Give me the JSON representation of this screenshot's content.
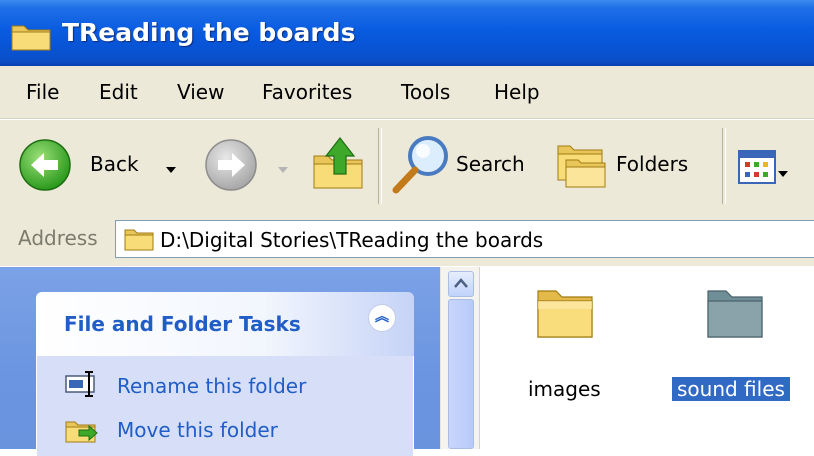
{
  "window": {
    "title": "TReading the boards"
  },
  "menu": {
    "items": [
      "File",
      "Edit",
      "View",
      "Favorites",
      "Tools",
      "Help"
    ]
  },
  "toolbar": {
    "back_label": "Back",
    "search_label": "Search",
    "folders_label": "Folders"
  },
  "address": {
    "label": "Address",
    "value": "D:\\Digital Stories\\TReading the boards"
  },
  "task_panel": {
    "title": "File and Folder Tasks",
    "items": [
      {
        "label": "Rename this folder",
        "icon": "rename-icon"
      },
      {
        "label": "Move this folder",
        "icon": "move-icon"
      }
    ]
  },
  "files": [
    {
      "name": "images",
      "selected": false
    },
    {
      "name": "sound files",
      "selected": true
    }
  ],
  "colors": {
    "title_bar": "#0a5ce0",
    "task_pane": "#6b95e0",
    "task_link": "#215dc6",
    "selection": "#316ac5"
  }
}
